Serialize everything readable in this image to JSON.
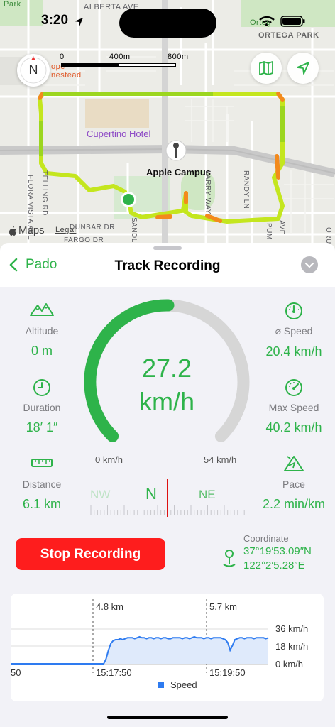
{
  "status_bar": {
    "time": "3:20"
  },
  "map": {
    "compass_letter": "N",
    "scale": {
      "labels": [
        "0",
        "400m",
        "800m"
      ]
    },
    "labels": {
      "alberta": "ALBERTA AVE",
      "park_top": "Park",
      "ortega_park": "ORTEGA PARK",
      "ortega_short": "Orteg",
      "homestead_1": "ope",
      "homestead_2": "nestead",
      "hotel": "Cupertino Hotel",
      "campus": "Apple Campus",
      "larry": "LARRY WAY",
      "randy": "RANDY LN",
      "tilling": "TELLING RD",
      "flora": "FLORA VISTA AVE",
      "dunbar": "DUNBAR DR",
      "fargo": "FARGO DR",
      "sandl": "SANDL",
      "pum": "PUM",
      "ave": "AVE",
      "oru": "ORU",
      "maps": "Maps",
      "legal": "Legal"
    }
  },
  "header": {
    "back_label": "Pado",
    "title": "Track Recording"
  },
  "metrics": {
    "altitude": {
      "label": "Altitude",
      "value": "0 m"
    },
    "duration": {
      "label": "Duration",
      "value": "18′ 1″"
    },
    "distance": {
      "label": "Distance",
      "value": "6.1 km"
    },
    "avg_speed": {
      "label": "⌀ Speed",
      "value": "20.4 km/h"
    },
    "max_speed": {
      "label": "Max Speed",
      "value": "40.2 km/h"
    },
    "pace": {
      "label": "Pace",
      "value": "2.2 min/km"
    }
  },
  "gauge": {
    "value": "27.2",
    "unit": "km/h",
    "min_label": "0 km/h",
    "max_label": "54 km/h",
    "fraction": 0.504
  },
  "heading": {
    "left": "NW",
    "center": "N",
    "right": "NE"
  },
  "stop_button": "Stop Recording",
  "coordinate": {
    "label": "Coordinate",
    "lat": "37°19′53.09″N",
    "lon": "122°2′5.28″E"
  },
  "colors": {
    "accent": "#2eb34a",
    "stop": "#fe1d1d",
    "series": "#2e7bf0"
  },
  "chart_data": {
    "type": "area",
    "x_tick_labels": [
      "50",
      "15:17:50",
      "15:19:50"
    ],
    "top_markers": [
      "4.8 km",
      "5.7 km"
    ],
    "y_tick_labels": [
      "36 km/h",
      "18 km/h",
      "0 km/h"
    ],
    "ylim": [
      0,
      36
    ],
    "series": [
      {
        "name": "Speed",
        "values": [
          0,
          0,
          0,
          0,
          0,
          0,
          0,
          0,
          0,
          0,
          0,
          0,
          0,
          0,
          0,
          0,
          0,
          0,
          0,
          0,
          0,
          0,
          0,
          0,
          0,
          0,
          0,
          0,
          0,
          0,
          0,
          0,
          0,
          0,
          0,
          0,
          0,
          0,
          0,
          0,
          5,
          14,
          21,
          24,
          25,
          25,
          26,
          25,
          26,
          27,
          27,
          27,
          26,
          27,
          28,
          27,
          27,
          26,
          27,
          27,
          26,
          27,
          27,
          26,
          27,
          27,
          26,
          26,
          27,
          27,
          27,
          27,
          26,
          27,
          27,
          26,
          27,
          28,
          27,
          27,
          27,
          26,
          27,
          27,
          26,
          27,
          27,
          27,
          27,
          26,
          25,
          22,
          14,
          19,
          25,
          26,
          27,
          27,
          26,
          27,
          27,
          27,
          26,
          27,
          27,
          27,
          27,
          26,
          27
        ]
      }
    ]
  }
}
